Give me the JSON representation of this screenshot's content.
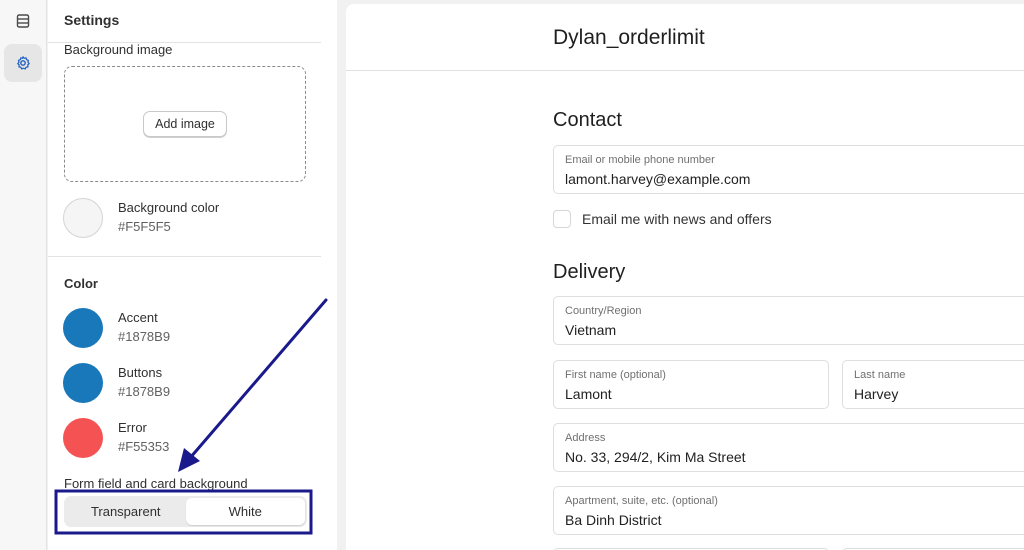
{
  "colors": {
    "accent": "#1878B9",
    "buttons": "#1878B9",
    "error": "#F55353",
    "background": "#F5F5F5",
    "annotation": "#1a1a8c"
  },
  "rail": {
    "items": [
      {
        "icon": "sections-icon"
      },
      {
        "icon": "settings-gear-icon",
        "active": true
      }
    ]
  },
  "settings": {
    "title": "Settings",
    "background_image": {
      "label": "Background image",
      "add_button": "Add image"
    },
    "background_color": {
      "name": "Background color",
      "hex": "#F5F5F5"
    },
    "color_section": {
      "title": "Color",
      "swatches": [
        {
          "name": "Accent",
          "hex": "#1878B9"
        },
        {
          "name": "Buttons",
          "hex": "#1878B9"
        },
        {
          "name": "Error",
          "hex": "#F55353"
        }
      ]
    },
    "form_background": {
      "label": "Form field and card background",
      "options": [
        "Transparent",
        "White"
      ],
      "selected": "White"
    }
  },
  "preview": {
    "shop_name": "Dylan_orderlimit",
    "contact": {
      "title": "Contact",
      "email_label": "Email or mobile phone number",
      "email_value": "lamont.harvey@example.com",
      "newsletter_label": "Email me with news and offers"
    },
    "delivery": {
      "title": "Delivery",
      "country_label": "Country/Region",
      "country_value": "Vietnam",
      "first_name_label": "First name (optional)",
      "first_name_value": "Lamont",
      "last_name_label": "Last name",
      "last_name_value": "Harvey",
      "address_label": "Address",
      "address_value": "No. 33, 294/2, Kim Ma Street",
      "apartment_label": "Apartment, suite, etc. (optional)",
      "apartment_value": "Ba Dinh District"
    }
  }
}
